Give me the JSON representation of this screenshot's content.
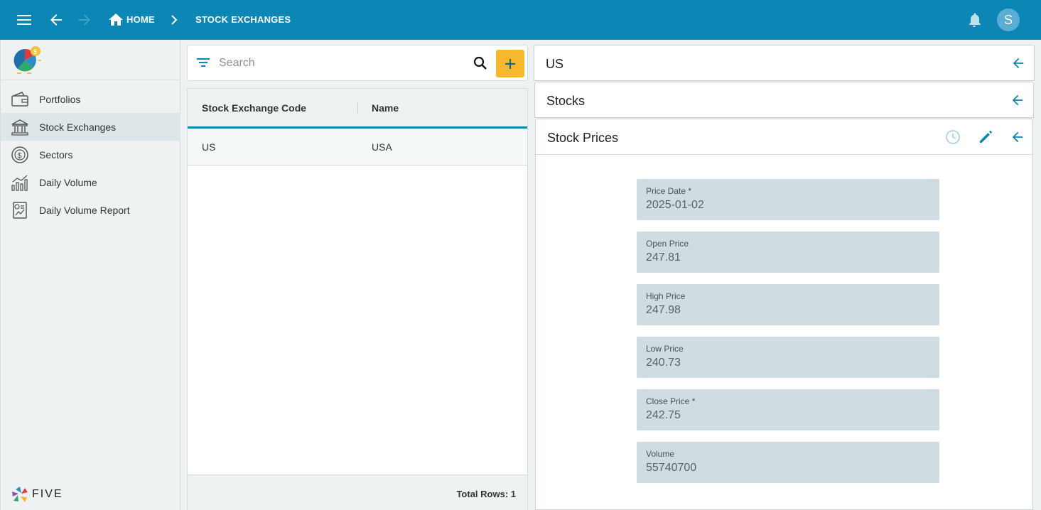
{
  "header": {
    "breadcrumbs": [
      "HOME",
      "STOCK EXCHANGES"
    ],
    "user_initial": "S",
    "accent": "#0b86b5"
  },
  "sidebar": {
    "items": [
      {
        "label": "Portfolios",
        "icon": "wallet-icon"
      },
      {
        "label": "Stock Exchanges",
        "icon": "bank-icon",
        "active": true
      },
      {
        "label": "Sectors",
        "icon": "dollar-circle-icon"
      },
      {
        "label": "Daily Volume",
        "icon": "bar-chart-icon"
      },
      {
        "label": "Daily Volume Report",
        "icon": "report-icon"
      }
    ],
    "brand": "FIVE"
  },
  "list": {
    "search_placeholder": "Search",
    "columns": [
      "Stock Exchange Code",
      "Name"
    ],
    "rows": [
      {
        "code": "US",
        "name": "USA"
      }
    ],
    "footer": "Total Rows: 1"
  },
  "detail": {
    "panels": [
      "US",
      "Stocks",
      "Stock Prices"
    ],
    "fields": [
      {
        "label": "Price Date *",
        "value": "2025-01-02"
      },
      {
        "label": "Open Price",
        "value": "247.81"
      },
      {
        "label": "High Price",
        "value": "247.98"
      },
      {
        "label": "Low Price",
        "value": "240.73"
      },
      {
        "label": "Close Price *",
        "value": "242.75"
      },
      {
        "label": "Volume",
        "value": "55740700"
      }
    ]
  }
}
